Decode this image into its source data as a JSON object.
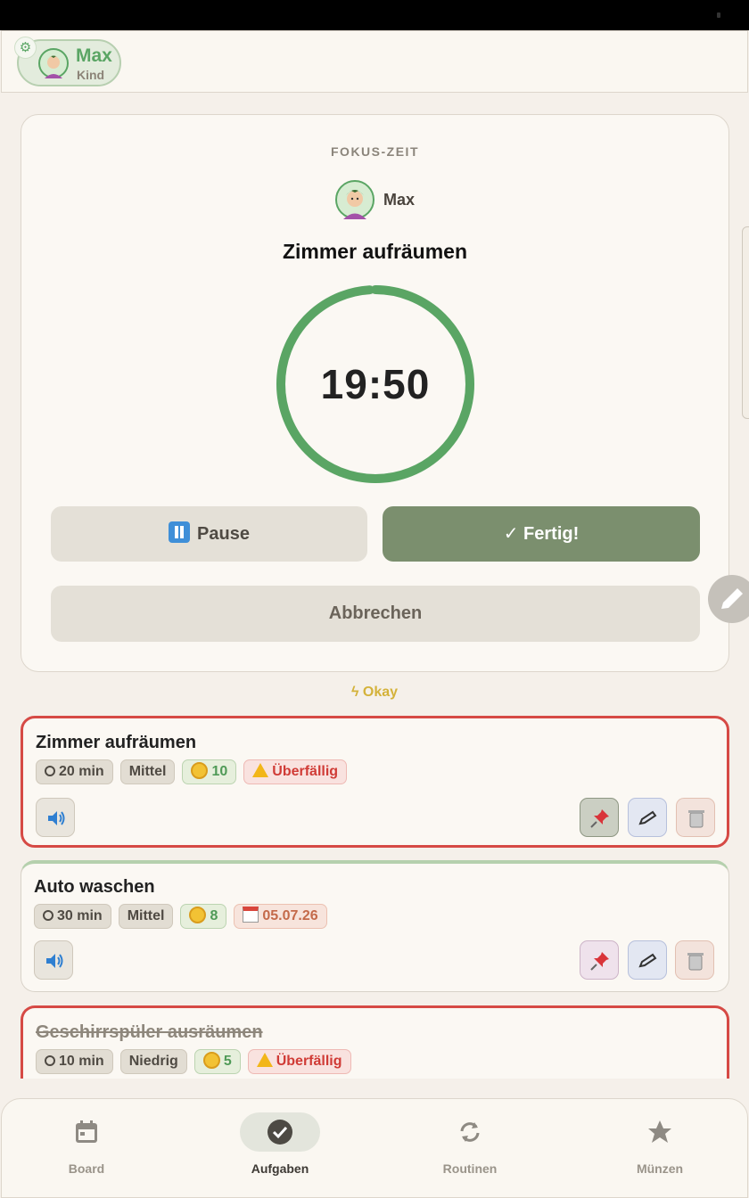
{
  "header": {
    "profile": {
      "name": "Max",
      "role": "Kind"
    }
  },
  "focus": {
    "label": "FOKUS-ZEIT",
    "user": "Max",
    "task_title": "Zimmer aufräumen",
    "time_display": "19:50",
    "progress_fraction": 0.99,
    "pause_label": "Pause",
    "done_label": "✓ Fertig!",
    "cancel_label": "Abbrechen",
    "ring_color": "#5aa564"
  },
  "energy": {
    "label": "Okay"
  },
  "tasks": [
    {
      "title": "Zimmer aufräumen",
      "duration": "20 min",
      "level": "Mittel",
      "coins": "10",
      "status": "Überfällig",
      "overdue": true,
      "pinned": true
    },
    {
      "title": "Auto waschen",
      "duration": "30 min",
      "level": "Mittel",
      "coins": "8",
      "date": "05.07.26",
      "overdue": false,
      "pinned": false
    },
    {
      "title": "Geschirrspüler ausräumen",
      "duration": "10 min",
      "level": "Niedrig",
      "coins": "5",
      "status": "Überfällig",
      "overdue": true,
      "completed": true
    }
  ],
  "nav": {
    "items": [
      {
        "label": "Board",
        "icon": "calendar-icon"
      },
      {
        "label": "Aufgaben",
        "icon": "check-circle-icon",
        "active": true
      },
      {
        "label": "Routinen",
        "icon": "sync-icon"
      },
      {
        "label": "Münzen",
        "icon": "star-icon"
      }
    ]
  }
}
